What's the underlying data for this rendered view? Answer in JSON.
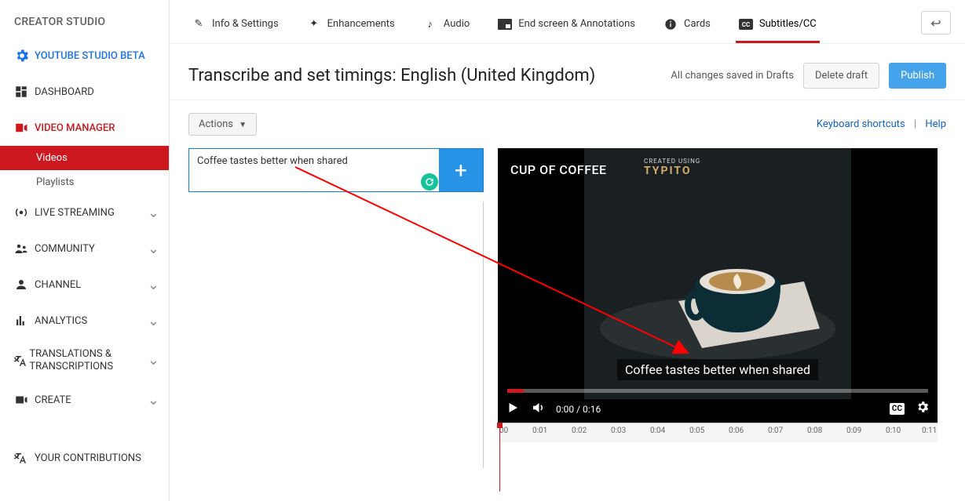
{
  "app_title": "CREATOR STUDIO",
  "sidebar": {
    "studio_beta": "YOUTUBE STUDIO BETA",
    "dashboard": "DASHBOARD",
    "video_manager": "VIDEO MANAGER",
    "videos": "Videos",
    "playlists": "Playlists",
    "live": "LIVE STREAMING",
    "community": "COMMUNITY",
    "channel": "CHANNEL",
    "analytics": "ANALYTICS",
    "translations": "TRANSLATIONS & TRANSCRIPTIONS",
    "create": "CREATE",
    "contributions": "YOUR CONTRIBUTIONS"
  },
  "tabs": {
    "info": "Info & Settings",
    "enhance": "Enhancements",
    "audio": "Audio",
    "endscreen": "End screen & Annotations",
    "cards": "Cards",
    "subtitles": "Subtitles/CC"
  },
  "header": {
    "title": "Transcribe and set timings: English (United Kingdom)",
    "save_status": "All changes saved in Drafts",
    "delete": "Delete draft",
    "publish": "Publish"
  },
  "actions_label": "Actions",
  "links": {
    "shortcuts": "Keyboard shortcuts",
    "help": "Help"
  },
  "caption": {
    "text": "Coffee tastes better when shared"
  },
  "video": {
    "title": "CUP OF COFFEE",
    "watermark_top": "CREATED USING",
    "watermark": "TYPITO",
    "subtitle_text": "Coffee tastes better when shared",
    "time_display": "0:00 / 0:16"
  },
  "timeline": {
    "ticks": [
      "00",
      "0:01",
      "0:02",
      "0:03",
      "0:04",
      "0:05",
      "0:06",
      "0:07",
      "0:08",
      "0:09",
      "0:10",
      "0:11"
    ]
  }
}
